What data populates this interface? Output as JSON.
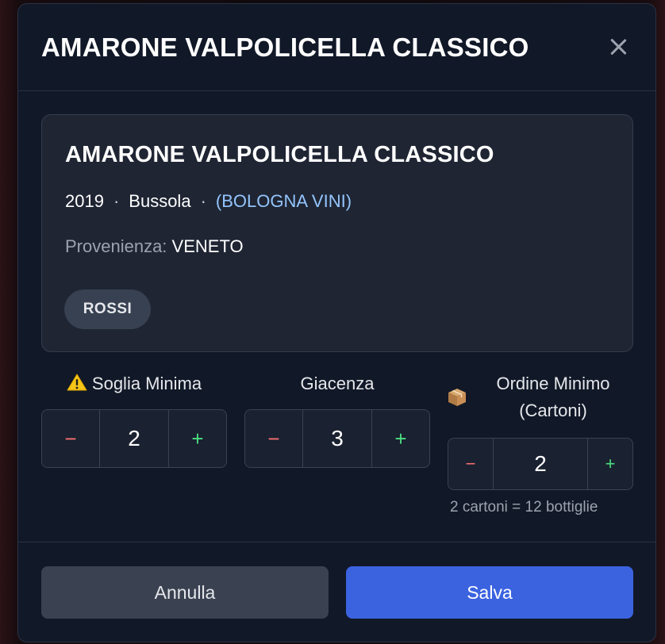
{
  "modal": {
    "title": "AMARONE VALPOLICELLA CLASSICO",
    "close_icon": "close-icon"
  },
  "wine_card": {
    "name": "AMARONE VALPOLICELLA CLASSICO",
    "year": "2019",
    "producer": "Bussola",
    "separator": "·",
    "supplier": "(BOLOGNA VINI)",
    "origin_label": "Provenienza:",
    "origin_value": "VENETO",
    "category_badge": "ROSSI"
  },
  "fields": {
    "soglia_minima": {
      "label": "Soglia Minima",
      "icon": "warning-icon",
      "value": "2",
      "minus": "−",
      "plus": "+"
    },
    "giacenza": {
      "label": "Giacenza",
      "value": "3",
      "minus": "−",
      "plus": "+"
    },
    "ordine_minimo": {
      "label_line1": "Ordine Minimo",
      "label_line2": "(Cartoni)",
      "icon": "package-icon",
      "value": "2",
      "minus": "−",
      "plus": "+",
      "hint": "2 cartoni = 12 bottiglie"
    }
  },
  "footer": {
    "cancel_label": "Annulla",
    "save_label": "Salva"
  },
  "colors": {
    "accent": "#3b63e0",
    "supplier": "#93c5fd",
    "minus": "#f87171",
    "plus": "#4ade80"
  }
}
